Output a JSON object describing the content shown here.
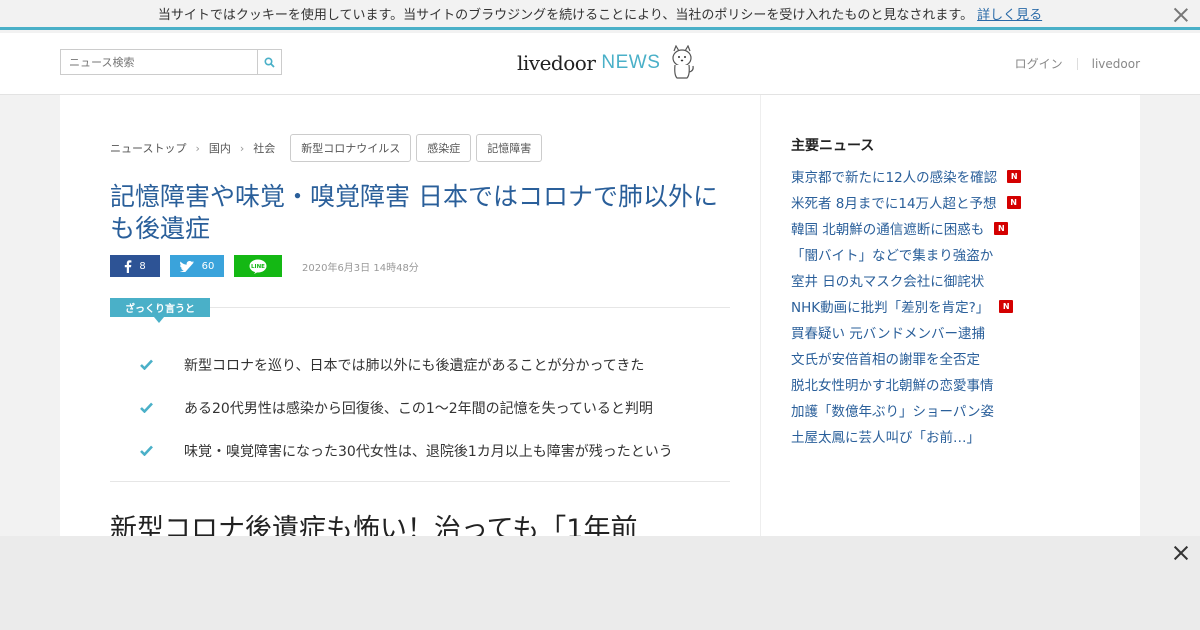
{
  "cookie": {
    "message": "当サイトではクッキーを使用しています。当サイトのブラウジングを続けることにより、当社のポリシーを受け入れたものと見なされます。",
    "link": "詳しく見る"
  },
  "header": {
    "search_placeholder": "ニュース検索",
    "logo_main": "livedoor",
    "logo_news": "NEWS",
    "login": "ログイン",
    "livedoor": "livedoor"
  },
  "breadcrumb": [
    "ニューストップ",
    "国内",
    "社会"
  ],
  "tags": [
    "新型コロナウイルス",
    "感染症",
    "記憶障害"
  ],
  "article": {
    "title": "記憶障害や味覚・嗅覚障害 日本ではコロナで肺以外にも後遺症",
    "share": {
      "facebook": "8",
      "twitter": "60"
    },
    "date": "2020年6月3日 14時48分",
    "summary_label": "ざっくり言うと",
    "points": [
      "新型コロナを巡り、日本では肺以外にも後遺症があることが分かってきた",
      "ある20代男性は感染から回復後、この1～2年間の記憶を失っていると判明",
      "味覚・嗅覚障害になった30代女性は、退院後1カ月以上も障害が残ったという"
    ],
    "subheading": "新型コロナ後遺症も怖い！治っても「1年前"
  },
  "sidebar": {
    "title": "主要ニュース",
    "badge": "N",
    "items": [
      {
        "text": "東京都で新たに12人の感染を確認",
        "new": true
      },
      {
        "text": "米死者 8月までに14万人超と予想",
        "new": true
      },
      {
        "text": "韓国 北朝鮮の通信遮断に困惑も",
        "new": true
      },
      {
        "text": "「闇バイト」などで集まり強盗か",
        "new": false
      },
      {
        "text": "室井 日の丸マスク会社に御詫状",
        "new": false
      },
      {
        "text": "NHK動画に批判「差別を肯定?」",
        "new": true
      },
      {
        "text": "買春疑い 元バンドメンバー逮捕",
        "new": false
      },
      {
        "text": "文氏が安倍首相の謝罪を全否定",
        "new": false
      },
      {
        "text": "脱北女性明かす北朝鮮の恋愛事情",
        "new": false
      },
      {
        "text": "加護「数億年ぶり」ショーパン姿",
        "new": false
      },
      {
        "text": "土屋太鳳に芸人叫び「お前…」",
        "new": false
      }
    ]
  },
  "colors": {
    "accent": "#4ab0c8",
    "link": "#2a5f9a",
    "facebook": "#2d5395",
    "twitter": "#3aa3db",
    "line": "#14b814",
    "new_badge": "#d40000"
  }
}
